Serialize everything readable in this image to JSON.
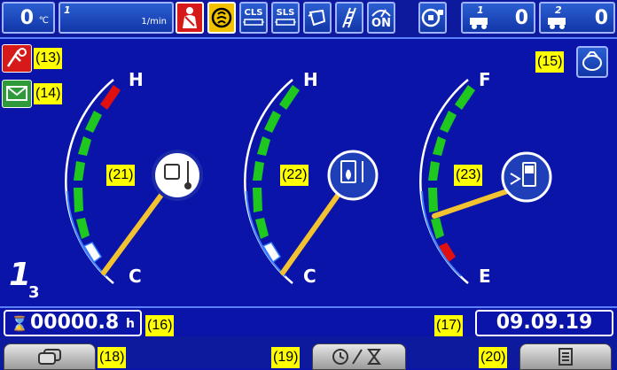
{
  "top_bar": {
    "temperature": {
      "value": "0",
      "unit": "℃"
    },
    "rpm": {
      "index": "1",
      "unit": "1/min",
      "value": ""
    },
    "indicators": {
      "cls_label": "CLS",
      "sls_label": "SLS",
      "on_label": "ON"
    },
    "counter1": {
      "index": "1",
      "value": "0"
    },
    "counter2": {
      "index": "2",
      "value": "0"
    }
  },
  "callouts": {
    "c13": "(13)",
    "c14": "(14)",
    "c15": "(15)",
    "c16": "(16)",
    "c17": "(17)",
    "c18": "(18)",
    "c19": "(19)",
    "c20": "(20)",
    "c21": "(21)",
    "c22": "(22)",
    "c23": "(23)"
  },
  "gauges": [
    {
      "id": "coolant-temp",
      "top_label": "H",
      "bottom_label": "C",
      "icon": "coolant-temperature-icon",
      "level": 0.05
    },
    {
      "id": "hydraulic-oil-temp",
      "top_label": "H",
      "bottom_label": "C",
      "icon": "hydraulic-oil-temperature-icon",
      "level": 0.05
    },
    {
      "id": "fuel-level",
      "top_label": "F",
      "bottom_label": "E",
      "icon": "fuel-icon",
      "level": 0.28
    }
  ],
  "page_indicator": {
    "current": "1",
    "total": "3"
  },
  "hour_meter": {
    "value": "00000.8",
    "unit": "h"
  },
  "date": {
    "value": "09.09.19"
  },
  "colors": {
    "background": "#0a14a8",
    "gauge_green": "#1ec81e",
    "gauge_red": "#e01010",
    "needle": "#f2c230",
    "callout": "#ffff00"
  }
}
